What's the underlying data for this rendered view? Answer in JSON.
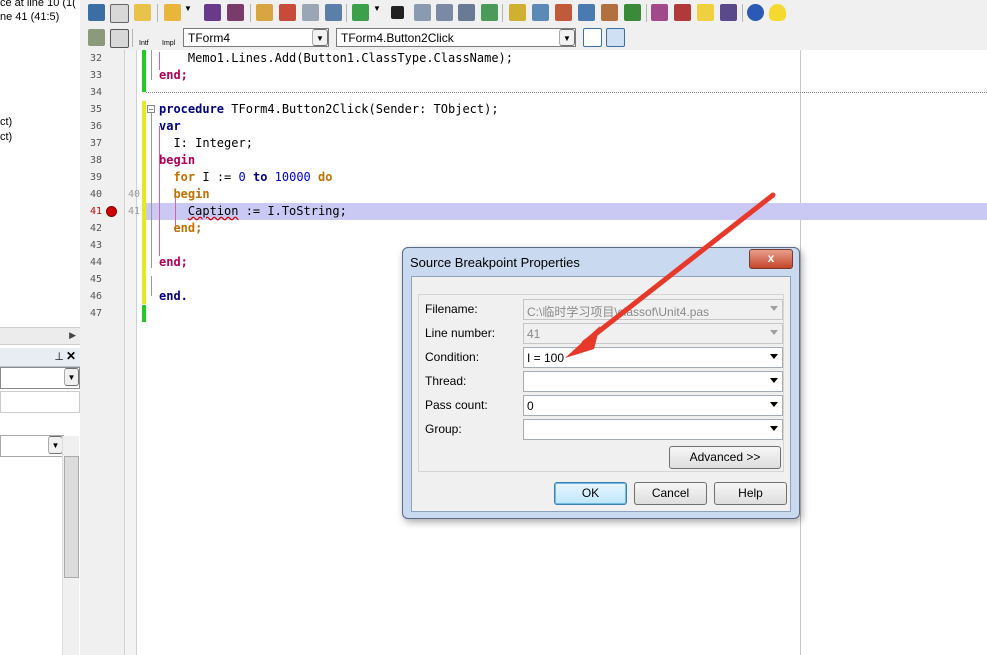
{
  "left_panel": {
    "line1": "ce at line 10 (1(",
    "line2": "ne 41 (41:5)",
    "line3": "ct)",
    "line4": "ct)"
  },
  "toolbar": {
    "class_combo": "TForm4",
    "method_combo": "TForm4.Button2Click",
    "intf_label": "Intf",
    "impl_label": "Impl"
  },
  "editor": {
    "lines": [
      {
        "n": "32",
        "code": "  Memo1.Lines.Add(Button1.ClassType.ClassName);"
      },
      {
        "n": "33",
        "code": "end;"
      },
      {
        "n": "34",
        "code": ""
      },
      {
        "n": "35",
        "code": "procedure TForm4.Button2Click(Sender: TObject);"
      },
      {
        "n": "36",
        "code": "var"
      },
      {
        "n": "37",
        "code": "  I: Integer;"
      },
      {
        "n": "38",
        "code": "begin"
      },
      {
        "n": "39",
        "code": "  for I := 0 to 10000 do"
      },
      {
        "n": "40",
        "code": "  begin",
        "sub": "40"
      },
      {
        "n": "41",
        "code": "    Caption := I.ToString;",
        "sub": "41"
      },
      {
        "n": "42",
        "code": "  end;"
      },
      {
        "n": "43",
        "code": ""
      },
      {
        "n": "44",
        "code": "end;"
      },
      {
        "n": "45",
        "code": ""
      },
      {
        "n": "46",
        "code": "end."
      },
      {
        "n": "47",
        "code": ""
      }
    ]
  },
  "dialog": {
    "title": "Source Breakpoint Properties",
    "close": "x",
    "fields": {
      "filename": {
        "label": "Filename:",
        "value": "C:\\临时学习项目\\classof\\Unit4.pas"
      },
      "line_number": {
        "label": "Line number:",
        "value": "41"
      },
      "condition": {
        "label": "Condition:",
        "value": "I = 100"
      },
      "thread": {
        "label": "Thread:",
        "value": ""
      },
      "pass_count": {
        "label": "Pass count:",
        "value": "0"
      },
      "group": {
        "label": "Group:",
        "value": ""
      }
    },
    "advanced_button": "Advanced >>",
    "ok_button": "OK",
    "cancel_button": "Cancel",
    "help_button": "Help"
  },
  "colors": {
    "highlight_line": "#c9c9f3",
    "breakpoint": "#d00000",
    "annotation_arrow": "#e8382a"
  }
}
